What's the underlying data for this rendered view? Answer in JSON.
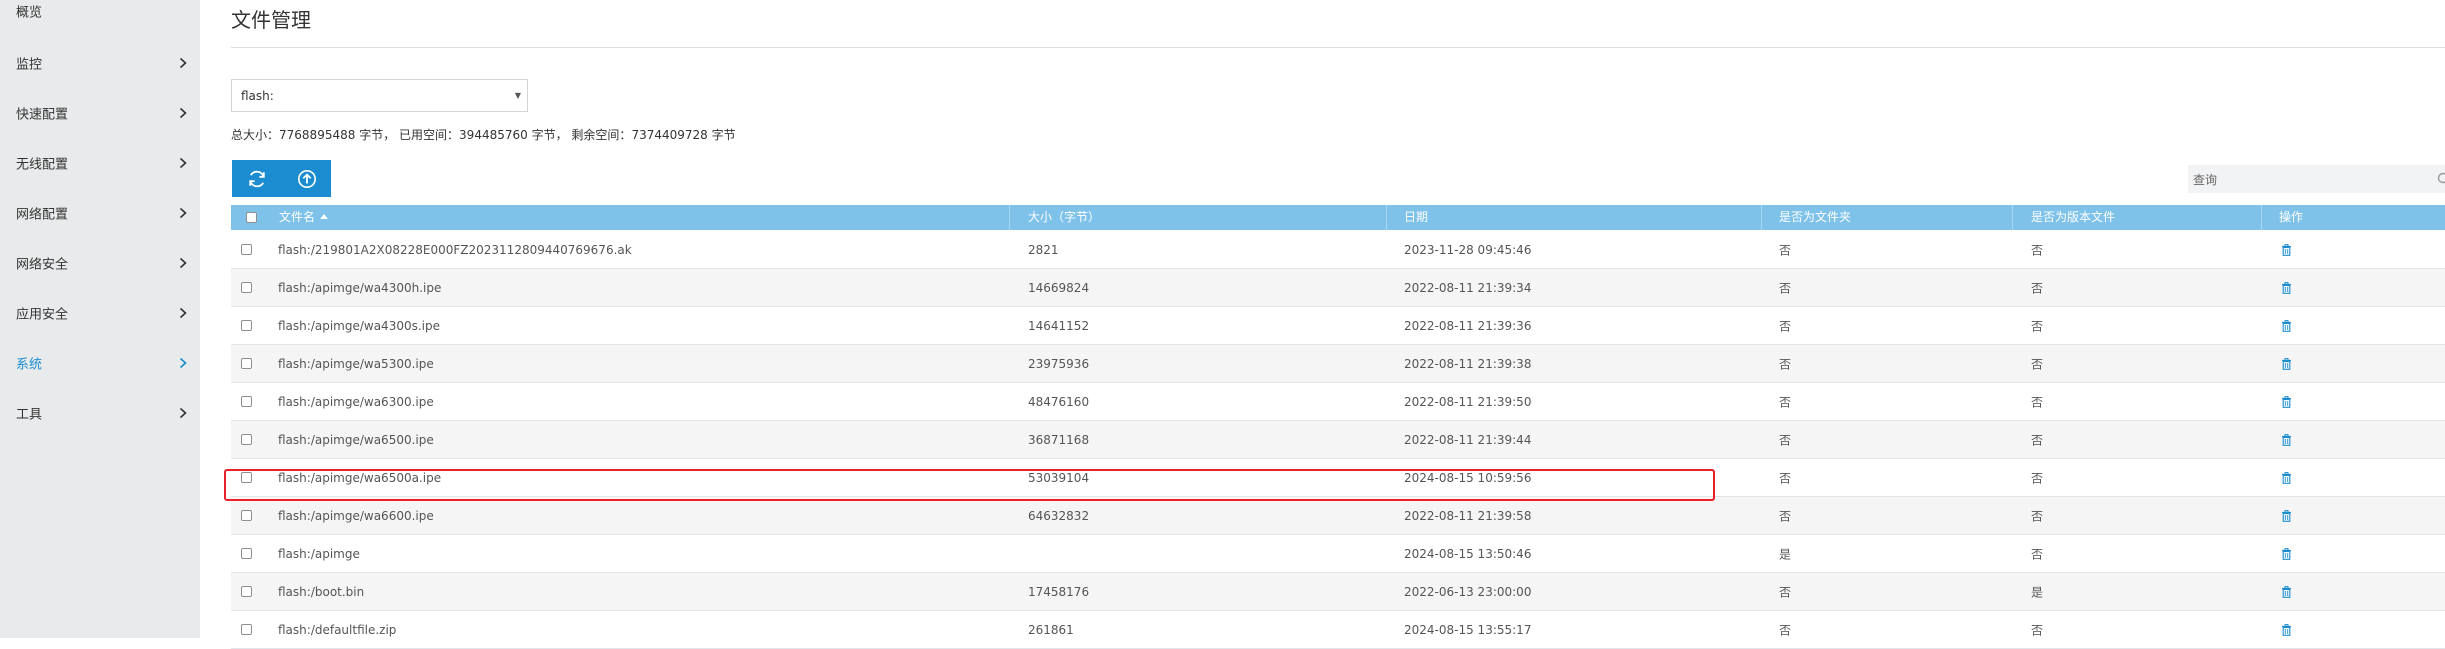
{
  "sidebar": {
    "items": [
      {
        "label": "概览",
        "active": false
      },
      {
        "label": "监控",
        "active": false
      },
      {
        "label": "快速配置",
        "active": false
      },
      {
        "label": "无线配置",
        "active": false
      },
      {
        "label": "网络配置",
        "active": false
      },
      {
        "label": "网络安全",
        "active": false
      },
      {
        "label": "应用安全",
        "active": false
      },
      {
        "label": "系统",
        "active": true
      },
      {
        "label": "工具",
        "active": false
      }
    ]
  },
  "page": {
    "title": "文件管理"
  },
  "storage_select": {
    "value": "flash:"
  },
  "storage": {
    "total_label": "总大小：",
    "total_value": "7768895488",
    "total_unit": " 字节，",
    "used_label": "已用空间：",
    "used_value": "394485760",
    "used_unit": " 字节，",
    "free_label": "剩余空间：",
    "free_value": "7374409728",
    "free_unit": " 字节"
  },
  "toolbar": {
    "refresh_icon": "refresh-icon",
    "upload_icon": "upload-icon"
  },
  "search": {
    "placeholder": "查询"
  },
  "table": {
    "headers": {
      "name": "文件名",
      "size": "大小（字节）",
      "date": "日期",
      "is_folder": "是否为文件夹",
      "is_version": "是否为版本文件",
      "action": "操作"
    },
    "rows": [
      {
        "name": "flash:/219801A2X08228E000FZ2023112809440769676.ak",
        "size": "2821",
        "date": "2023-11-28 09:45:46",
        "is_folder": "否",
        "is_version": "否"
      },
      {
        "name": "flash:/apimge/wa4300h.ipe",
        "size": "14669824",
        "date": "2022-08-11 21:39:34",
        "is_folder": "否",
        "is_version": "否"
      },
      {
        "name": "flash:/apimge/wa4300s.ipe",
        "size": "14641152",
        "date": "2022-08-11 21:39:36",
        "is_folder": "否",
        "is_version": "否"
      },
      {
        "name": "flash:/apimge/wa5300.ipe",
        "size": "23975936",
        "date": "2022-08-11 21:39:38",
        "is_folder": "否",
        "is_version": "否"
      },
      {
        "name": "flash:/apimge/wa6300.ipe",
        "size": "48476160",
        "date": "2022-08-11 21:39:50",
        "is_folder": "否",
        "is_version": "否"
      },
      {
        "name": "flash:/apimge/wa6500.ipe",
        "size": "36871168",
        "date": "2022-08-11 21:39:44",
        "is_folder": "否",
        "is_version": "否"
      },
      {
        "name": "flash:/apimge/wa6500a.ipe",
        "size": "53039104",
        "date": "2024-08-15 10:59:56",
        "is_folder": "否",
        "is_version": "否"
      },
      {
        "name": "flash:/apimge/wa6600.ipe",
        "size": "64632832",
        "date": "2022-08-11 21:39:58",
        "is_folder": "否",
        "is_version": "否"
      },
      {
        "name": "flash:/apimge",
        "size": "",
        "date": "2024-08-15 13:50:46",
        "is_folder": "是",
        "is_version": "否"
      },
      {
        "name": "flash:/boot.bin",
        "size": "17458176",
        "date": "2022-06-13 23:00:00",
        "is_folder": "否",
        "is_version": "是"
      },
      {
        "name": "flash:/defaultfile.zip",
        "size": "261861",
        "date": "2024-08-15 13:55:17",
        "is_folder": "否",
        "is_version": "否"
      }
    ]
  },
  "colors": {
    "accent": "#1b8ccf",
    "header_bg": "#7ec2ea",
    "sidebar_bg": "#e8eaeb",
    "highlight": "#e8212a"
  }
}
